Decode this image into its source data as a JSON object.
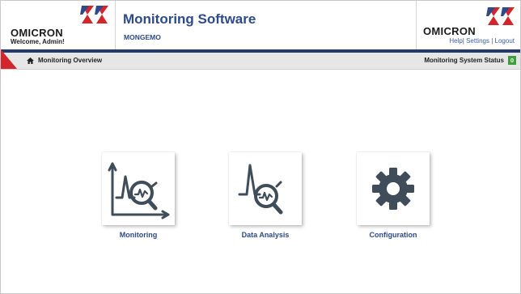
{
  "header": {
    "brand": "OMICRON",
    "welcome": "Welcome, Admin!",
    "title": "Monitoring Software",
    "subtitle": "MONGEMO",
    "links": {
      "help": "Help",
      "settings": "Settings",
      "logout": "Logout",
      "separator": "|"
    }
  },
  "navbar": {
    "breadcrumb": "Monitoring Overview",
    "status_label": "Monitoring System Status",
    "status_count": "0"
  },
  "tiles": [
    {
      "label": "Monitoring",
      "icon": "monitoring-chart-icon"
    },
    {
      "label": "Data Analysis",
      "icon": "data-analysis-icon"
    },
    {
      "label": "Configuration",
      "icon": "gear-icon"
    }
  ],
  "colors": {
    "brand_blue": "#2d4a8a",
    "brand_red": "#d3252c",
    "nav_dark": "#223a6e",
    "icon_gray": "#3f4d5a",
    "status_green": "#3f9d3b"
  }
}
